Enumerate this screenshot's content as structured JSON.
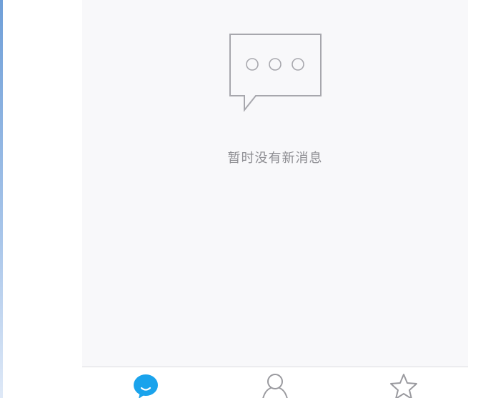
{
  "empty_state": {
    "icon": "chat-bubble-ellipsis-icon",
    "message": "暂时没有新消息"
  },
  "tab_bar": {
    "tabs": [
      {
        "icon": "message-bubble-icon",
        "active": true
      },
      {
        "icon": "person-icon",
        "active": false
      },
      {
        "icon": "star-icon",
        "active": false
      }
    ]
  },
  "colors": {
    "active_tab": "#1aa3ec",
    "inactive_tab": "#9a9a9f",
    "empty_text": "#8e8e93",
    "panel_background": "#f8f8fa"
  }
}
